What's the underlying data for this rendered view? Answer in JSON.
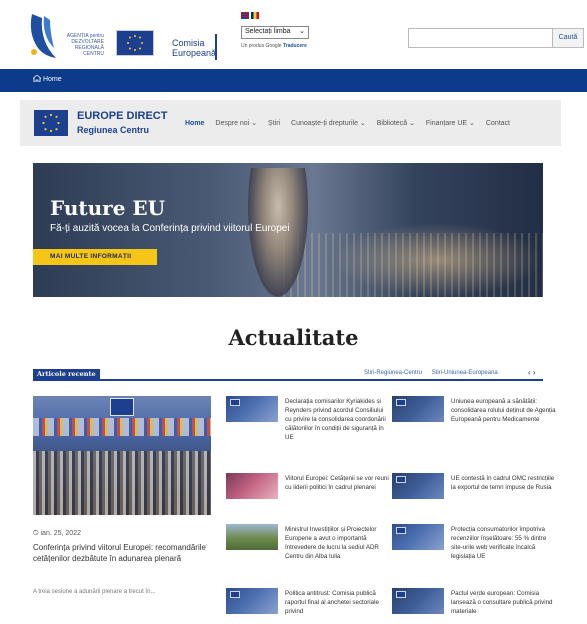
{
  "header": {
    "adr_logo_lines": [
      "AGENȚIA pentru",
      "DEZVOLTARE",
      "REGIONALĂ",
      "CENTRU"
    ],
    "ec_logo_line1": "Comisia",
    "ec_logo_line2": "Europeană",
    "language_select": "Selectați limba",
    "google_note_prefix": "Un produs Google",
    "google_note_link": "Traducere",
    "search_placeholder": "",
    "search_button": "Caută"
  },
  "bluebar": {
    "home_label": "Home"
  },
  "nav": {
    "brand_line1": "EUROPE DIRECT",
    "brand_line2": "Regiunea Centru",
    "items": [
      {
        "label": "Home"
      },
      {
        "label": "Despre noi ⌄"
      },
      {
        "label": "Știri"
      },
      {
        "label": "Cunoaște-ți drepturile ⌄"
      },
      {
        "label": "Bibliotecă ⌄"
      },
      {
        "label": "Finanțare UE ⌄"
      },
      {
        "label": "Contact"
      }
    ]
  },
  "hero": {
    "title": "Future EU",
    "subtitle": "Fă-ți auzită vocea la Conferința privind viitorul Europei",
    "button": "MAI MULTE INFORMAȚII"
  },
  "section": {
    "title": "Actualitate"
  },
  "articles": {
    "tab_label": "Articole recente",
    "filters": [
      "Stiri-Regiunea-Centru",
      "Stiri-Uniunea-Europeana"
    ],
    "arrows": "‹  ›",
    "featured": {
      "date": "ian. 25, 2022",
      "title": "Conferința privind viitorul Europei: recomandările cetățenilor dezbătute în adunarea plenară",
      "excerpt": "A treia sesiune a adunării plenare a trecut în..."
    },
    "news": [
      {
        "text": "Declarația comisarilor Kyriakides și Reynders privind acordul Consiliului cu privire la consolidarea coordonării călătoriilor în condiții de siguranță în UE"
      },
      {
        "text": "Uniunea europeană a sănătății: consolidarea rolului deținut de Agenția Europeană pentru Medicamente"
      },
      {
        "text": "Viitorul Europei: Cetățenii se vor reuni cu liderii politici în cadrul plenarei"
      },
      {
        "text": "UE contestă în cadrul OMC restricțiile la exportul de temn impuse de Rusia"
      },
      {
        "text": "Ministrul Investițiilor și Proiectelor Europene a avut o importantă întrevedere de lucru la sediul ADR Centru din Alba Iulia"
      },
      {
        "text": "Protecția consumatorilor împotriva recenziilor înșelătoare: 55 % dintre site-urile web verificate încalcă legislația UE"
      },
      {
        "text": "Politica antitrust: Comisia publică raportul final al anchetei sectoriale privind"
      },
      {
        "text": "Pactul verde european: Comisia lansează o consultare publică privind materiale"
      }
    ]
  }
}
